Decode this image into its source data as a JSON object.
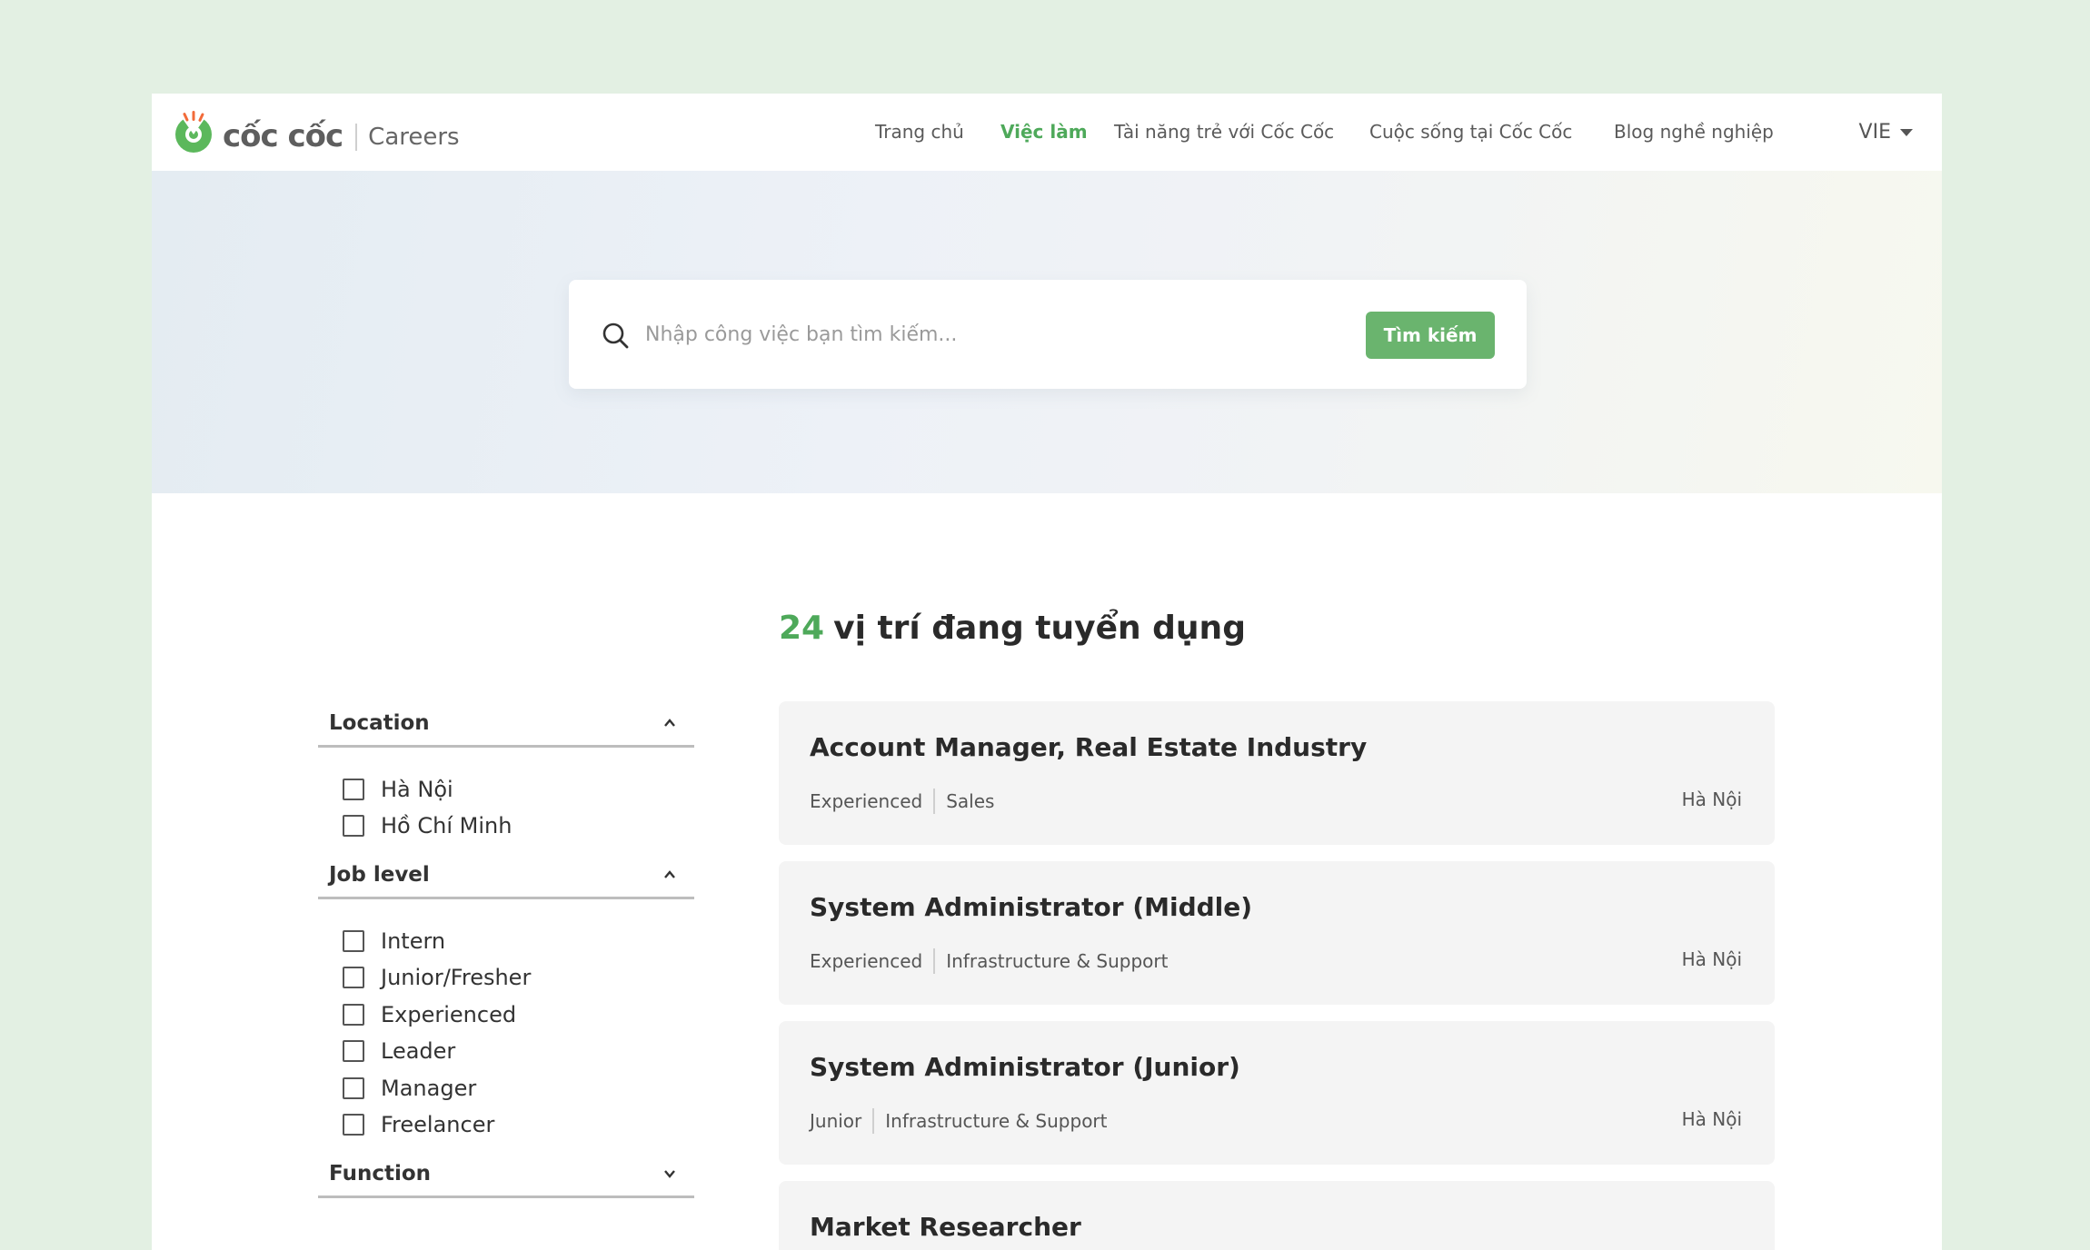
{
  "brand": {
    "name": "cốc cốc",
    "section": "Careers",
    "colors": {
      "accent": "#4ea95a",
      "button": "#6ab46e",
      "logo_green": "#5cb85c",
      "logo_orange": "#f26b3a"
    }
  },
  "nav": {
    "items": [
      {
        "label": "Trang chủ",
        "active": false
      },
      {
        "label": "Việc làm",
        "active": true
      },
      {
        "label": "Tài năng trẻ với Cốc Cốc",
        "active": false
      },
      {
        "label": "Cuộc sống tại Cốc Cốc",
        "active": false
      },
      {
        "label": "Blog nghề nghiệp",
        "active": false
      }
    ],
    "language": "VIE",
    "language_icon": "caret-down-icon"
  },
  "search": {
    "placeholder": "Nhập công việc bạn tìm kiếm...",
    "value": "",
    "button_label": "Tìm kiếm",
    "icon": "search-icon"
  },
  "results": {
    "count": "24",
    "label": "vị trí đang tuyển dụng"
  },
  "filters": [
    {
      "title": "Location",
      "expanded": true,
      "options": [
        "Hà Nội",
        "Hồ Chí Minh"
      ]
    },
    {
      "title": "Job level",
      "expanded": true,
      "options": [
        "Intern",
        "Junior/Fresher",
        "Experienced",
        "Leader",
        "Manager",
        "Freelancer"
      ]
    },
    {
      "title": "Function",
      "expanded": false,
      "options": []
    }
  ],
  "jobs": [
    {
      "title": "Account Manager, Real Estate Industry",
      "level": "Experienced",
      "function": "Sales",
      "location": "Hà Nội"
    },
    {
      "title": "System Administrator (Middle)",
      "level": "Experienced",
      "function": "Infrastructure & Support",
      "location": "Hà Nội"
    },
    {
      "title": "System Administrator (Junior)",
      "level": "Junior",
      "function": "Infrastructure & Support",
      "location": "Hà Nội"
    },
    {
      "title": "Market Researcher",
      "level": "",
      "function": "",
      "location": ""
    }
  ]
}
